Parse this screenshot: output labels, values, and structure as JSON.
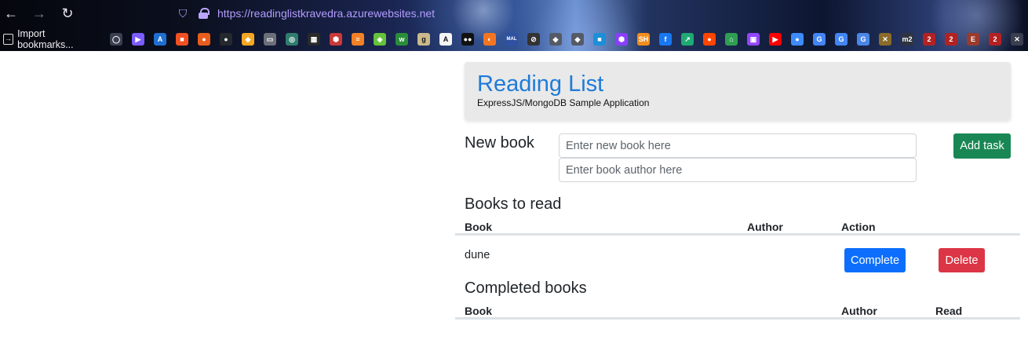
{
  "browser": {
    "url": "https://readinglistkravedra.azurewebsites.net",
    "import_bookmarks": "Import bookmarks...",
    "bookmark_icons": [
      {
        "name": "globe-icon",
        "color": "#3a3f4f",
        "glyph": "◯"
      },
      {
        "name": "bing-icon",
        "color": "#7b5cff",
        "glyph": "▶"
      },
      {
        "name": "azure-icon",
        "color": "#1f6fd1",
        "glyph": "A"
      },
      {
        "name": "microsoft-icon",
        "color": "#f25022",
        "glyph": "■"
      },
      {
        "name": "orange-bookmark-icon",
        "color": "#e85d1c",
        "glyph": "●"
      },
      {
        "name": "github-icon",
        "color": "#24292e",
        "glyph": "●"
      },
      {
        "name": "ubisoft-icon",
        "color": "#f5a623",
        "glyph": "◆"
      },
      {
        "name": "window-icon",
        "color": "#6b6f7a",
        "glyph": "▭"
      },
      {
        "name": "openai-icon",
        "color": "#2f7d6e",
        "glyph": "◎"
      },
      {
        "name": "pixel-icon",
        "color": "#2a2a2a",
        "glyph": "▦"
      },
      {
        "name": "red-hex-icon",
        "color": "#c93939",
        "glyph": "⬢"
      },
      {
        "name": "stackoverflow-icon",
        "color": "#f48024",
        "glyph": "≡"
      },
      {
        "name": "green-cube-icon",
        "color": "#65c23a",
        "glyph": "◈"
      },
      {
        "name": "wykop-icon",
        "color": "#2a8d3a",
        "glyph": "w"
      },
      {
        "name": "goodreads-icon",
        "color": "#c9b98b",
        "glyph": "g"
      },
      {
        "name": "archive-icon",
        "color": "#f5f5f5",
        "glyph": "A"
      },
      {
        "name": "medium-icon",
        "color": "#111111",
        "glyph": "●●"
      },
      {
        "name": "crunchyroll-icon",
        "color": "#f47521",
        "glyph": "◐"
      },
      {
        "name": "mal-icon",
        "color": "#2e51a2",
        "glyph": "MAL"
      },
      {
        "name": "circle-slash-icon",
        "color": "#333333",
        "glyph": "⊘"
      },
      {
        "name": "cube-grey-icon",
        "color": "#555a66",
        "glyph": "◆"
      },
      {
        "name": "cube-grey2-icon",
        "color": "#555a66",
        "glyph": "◆"
      },
      {
        "name": "jetbrains-icon",
        "color": "#1d8fd8",
        "glyph": "■"
      },
      {
        "name": "purple-shield-icon",
        "color": "#8a3ffc",
        "glyph": "⬢"
      },
      {
        "name": "sh-icon",
        "color": "#f28c1c",
        "glyph": "SH"
      },
      {
        "name": "facebook-icon",
        "color": "#1877f2",
        "glyph": "f"
      },
      {
        "name": "green-arrow-icon",
        "color": "#1faa74",
        "glyph": "↗"
      },
      {
        "name": "reddit-icon",
        "color": "#ff4500",
        "glyph": "●"
      },
      {
        "name": "home-icon",
        "color": "#2f9e53",
        "glyph": "⌂"
      },
      {
        "name": "twitch-icon",
        "color": "#9146ff",
        "glyph": "▣"
      },
      {
        "name": "youtube-icon",
        "color": "#ff0000",
        "glyph": "▶"
      },
      {
        "name": "drop-icon",
        "color": "#3d8bfd",
        "glyph": "●"
      },
      {
        "name": "google-icon",
        "color": "#4285f4",
        "glyph": "G"
      },
      {
        "name": "google2-icon",
        "color": "#4285f4",
        "glyph": "G"
      },
      {
        "name": "translate-icon",
        "color": "#4a86e8",
        "glyph": "G"
      },
      {
        "name": "game-crest-icon",
        "color": "#8a6b2a",
        "glyph": "✕"
      },
      {
        "name": "ff2-icon",
        "color": "#2f3440",
        "glyph": "m2"
      },
      {
        "name": "two-icon-a",
        "color": "#b22222",
        "glyph": "2"
      },
      {
        "name": "two-icon-b",
        "color": "#b22222",
        "glyph": "2"
      },
      {
        "name": "e-icon",
        "color": "#9a3b2e",
        "glyph": "E"
      },
      {
        "name": "two-icon-c",
        "color": "#b22222",
        "glyph": "2"
      },
      {
        "name": "crossed-icon",
        "color": "#3a3f4f",
        "glyph": "✕"
      }
    ]
  },
  "header": {
    "title": "Reading List",
    "subtitle": "ExpressJS/MongoDB Sample Application"
  },
  "new_book": {
    "label": "New book",
    "title_placeholder": "Enter new book here",
    "author_placeholder": "Enter book author here",
    "add_button": "Add task"
  },
  "to_read": {
    "title": "Books to read",
    "columns": [
      "Book",
      "Author",
      "Action"
    ],
    "rows": [
      {
        "book": "dune",
        "author": "",
        "complete_label": "Complete",
        "delete_label": "Delete"
      }
    ]
  },
  "completed": {
    "title": "Completed books",
    "columns": [
      "Book",
      "Author",
      "Read"
    ]
  }
}
